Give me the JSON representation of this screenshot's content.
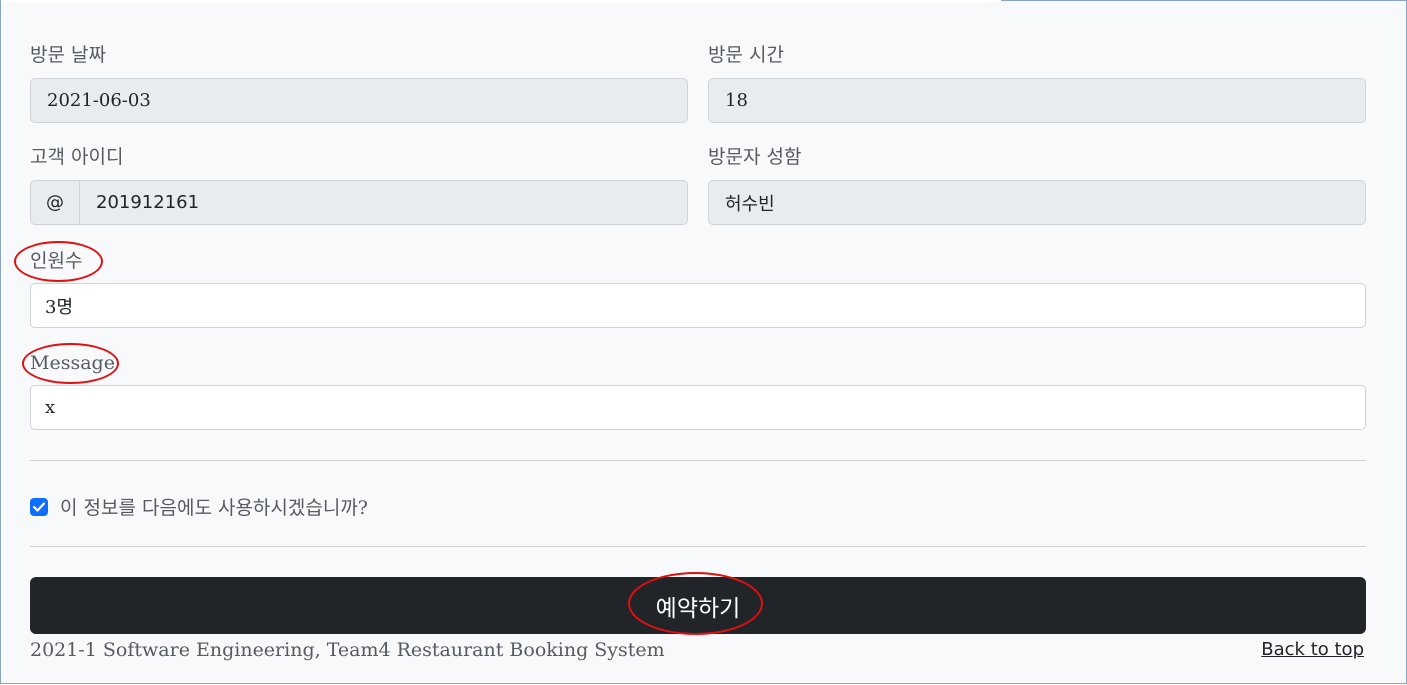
{
  "form": {
    "visit_date": {
      "label": "방문 날짜",
      "value": "2021-06-03"
    },
    "visit_time": {
      "label": "방문 시간",
      "value": "18"
    },
    "customer_id": {
      "label": "고객 아이디",
      "prefix": "@",
      "value": "201912161"
    },
    "visitor_name": {
      "label": "방문자 성함",
      "value": "허수빈"
    },
    "party_size": {
      "label": "인원수",
      "value": "3명"
    },
    "message": {
      "label": "Message",
      "value": "x"
    },
    "remember": {
      "label": "이 정보를 다음에도 사용하시겠습니까?",
      "checked": true
    },
    "submit_label": "예약하기"
  },
  "footer": {
    "text": "2021-1 Software Engineering, Team4 Restaurant Booking System",
    "back_to_top": "Back to top"
  },
  "colors": {
    "annotation_ring": "#e01010",
    "checkbox_accent": "#0d6efd",
    "button_bg": "#212529"
  }
}
